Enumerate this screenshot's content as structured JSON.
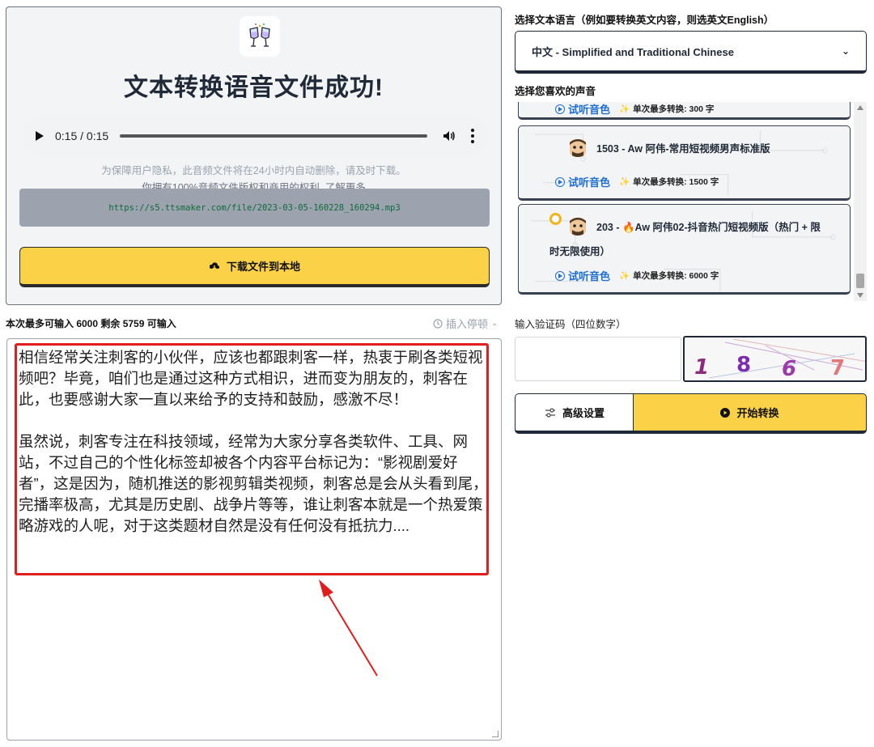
{
  "success": {
    "title": "文本转换语音文件成功!",
    "audio_time": "0:15 / 0:15",
    "audio_progress": 1.0,
    "privacy_note": "为保障用户隐私，此音频文件将在24小时内自动删除，请及时下载。",
    "rights_link": "你拥有100%音频文件版权和商用的权利, 了解更多",
    "file_url": "https://s5.ttsmaker.com/file/2023-03-05-160228_160294.mp3",
    "download_label": "下载文件到本地"
  },
  "input": {
    "limit_info": "本次最多可输入 6000 剩余 5759 可输入",
    "insert_pause_label": "插入停顿",
    "paragraphs": [
      "相信经常关注刺客的小伙伴，应该也都跟刺客一样，热衷于刷各类短视频吧？毕竟，咱们也是通过这种方式相识，进而变为朋友的，刺客在此，也要感谢大家一直以来给予的支持和鼓励，感激不尽！",
      "虽然说，刺客专注在科技领域，经常为大家分享各类软件、工具、网站，不过自己的个性化标签却被各个内容平台标记为：“影视剧爱好者”，这是因为，随机推送的影视剪辑类视频，刺客总是会从头看到尾，完播率极高，尤其是历史剧、战争片等等，谁让刺客本就是一个热爱策略游戏的人呢，对于这类题材自然是没有任何没有抵抗力...."
    ]
  },
  "language": {
    "label": "选择文本语言（例如要转换英文内容，则选英文English）",
    "selected": "中文 - Simplified and Traditional Chinese"
  },
  "voices": {
    "label": "选择您喜欢的声音",
    "partial_top_listen": "试听音色",
    "partial_top_chars": "单次最多转换: 300 字",
    "items": [
      {
        "name": "1503 - Aw 阿伟-常用短视频男声标准版",
        "listen": "试听音色",
        "max_chars": "单次最多转换: 1500 字"
      },
      {
        "name_line1": "203 - ",
        "name_fire": "Aw 阿伟02-抖音热门短视频版（热门 + 限",
        "name_line2": "时无限使用）",
        "listen": "试听音色",
        "max_chars": "单次最多转换: 6000 字"
      }
    ]
  },
  "captcha": {
    "label": "输入验证码（四位数字）",
    "input_value": "",
    "image_digits": [
      "1",
      "8",
      "6",
      "7"
    ]
  },
  "actions": {
    "advanced_label": "高级设置",
    "start_label": "开始转换"
  }
}
